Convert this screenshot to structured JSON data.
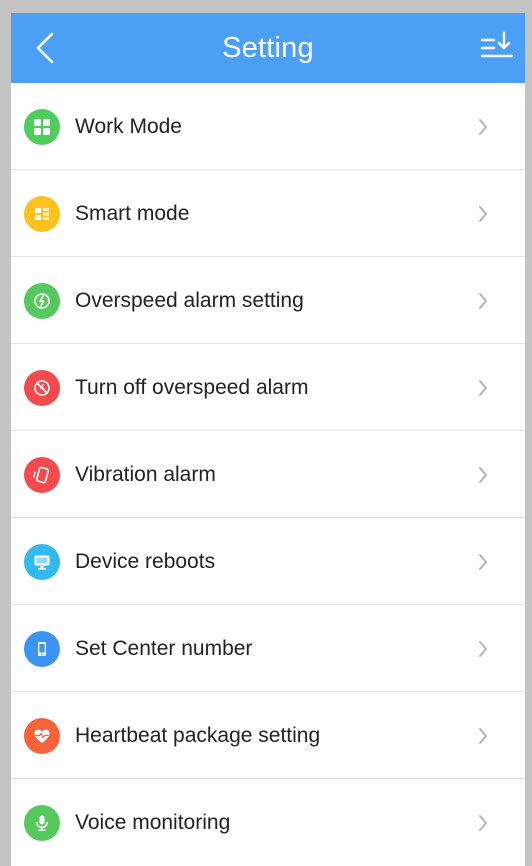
{
  "header": {
    "title": "Setting",
    "back_icon": "chevron-left-icon",
    "sort_icon": "sort-descending-icon",
    "color": "#4b9ff5"
  },
  "items": [
    {
      "label": "Work Mode",
      "icon": "grid-icon",
      "color": "#4fcd5c"
    },
    {
      "label": "Smart mode",
      "icon": "layout-icon",
      "color": "#fcc11c"
    },
    {
      "label": "Overspeed alarm setting",
      "icon": "speed-icon",
      "color": "#55c95e"
    },
    {
      "label": "Turn off overspeed alarm",
      "icon": "speed-off-icon",
      "color": "#f44a4e"
    },
    {
      "label": "Vibration alarm",
      "icon": "phone-vibrate-icon",
      "color": "#f44a4e"
    },
    {
      "label": "Device reboots",
      "icon": "monitor-icon",
      "color": "#31b9f0"
    },
    {
      "label": "Set Center number",
      "icon": "phone-icon",
      "color": "#3d95f3"
    },
    {
      "label": "Heartbeat package setting",
      "icon": "heartbeat-icon",
      "color": "#f5633a"
    },
    {
      "label": "Voice monitoring",
      "icon": "microphone-icon",
      "color": "#55c95e"
    }
  ]
}
